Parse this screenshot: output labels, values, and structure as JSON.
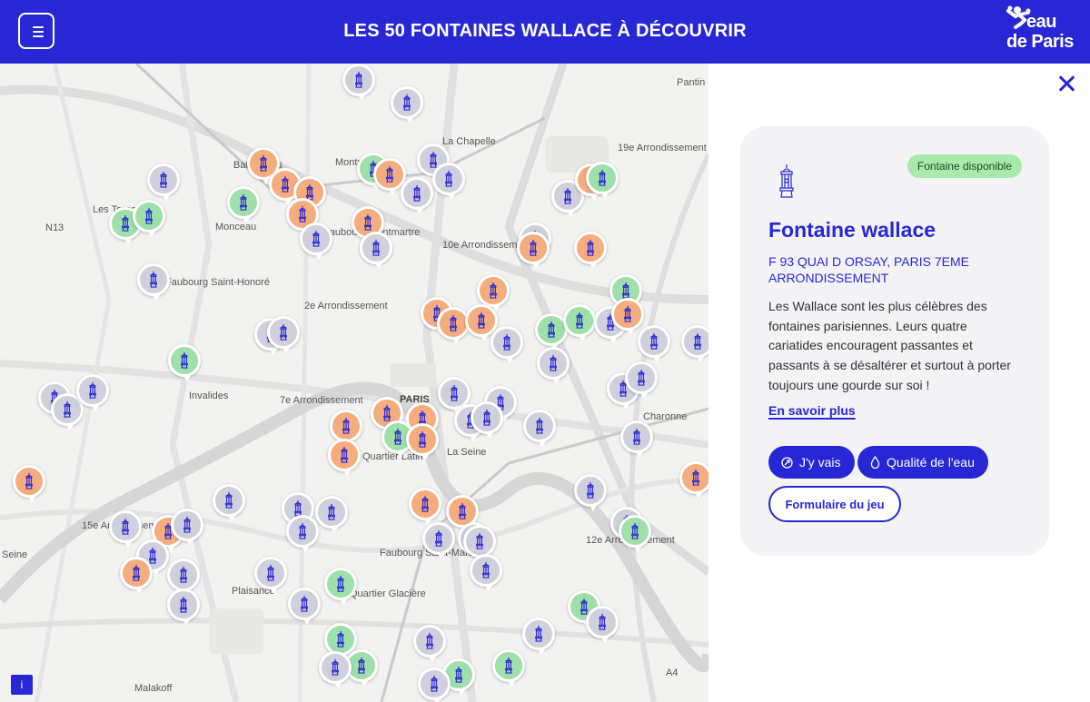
{
  "header": {
    "title": "LES 50 FONTAINES WALLACE À DÉCOUVRIR",
    "menu_icon": "hamburger-icon",
    "logo_line1": "eau",
    "logo_line2": "de Paris"
  },
  "map": {
    "labels": [
      "Pantin",
      "19e Arrondissement",
      "La Chapelle",
      "Montmartre",
      "Batignolles",
      "Les Ternes",
      "Monceau",
      "Faubourg Montmartre",
      "10e Arrondissement",
      "Faubourg Saint-Honoré",
      "2e Arrondissement",
      "Invalides",
      "7e Arrondissement",
      "PARIS",
      "La Seine",
      "Charonne",
      "Quartier Latin",
      "15e Arrondissement",
      "Faubourg Saint-Marceau",
      "12e Arrondissement",
      "Plaisance",
      "Quartier Glacière",
      "Malakoff",
      "Seine",
      "N13",
      "A4"
    ],
    "info_label": "i"
  },
  "panel": {
    "close_icon": "close-icon",
    "badge": "Fontaine disponible",
    "title": "Fontaine wallace",
    "address": "F 93 QUAI D ORSAY, PARIS 7EME ARRONDISSEMENT",
    "description": "Les Wallace sont les plus célèbres des fontaines parisiennes. Leurs quatre cariatides encouragent passantes et passants à se désaltérer et surtout à porter toujours une gourde sur soi !",
    "link": "En savoir plus",
    "btn_go": "J'y vais",
    "btn_quality": "Qualité de l'eau",
    "btn_form": "Formulaire du jeu"
  },
  "colors": {
    "brand": "#2727d6",
    "pin_available": "#9fe0a8",
    "pin_orange": "#f5ad7e",
    "pin_grey": "#cfd0dc",
    "badge": "#a8eaa9"
  }
}
